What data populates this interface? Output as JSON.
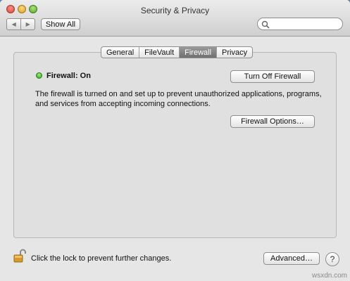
{
  "window": {
    "title": "Security & Privacy",
    "nav": {
      "back_icon": "chevron-left-icon",
      "forward_icon": "chevron-right-icon"
    },
    "show_all_label": "Show All",
    "search": {
      "placeholder": "",
      "icon": "search-icon"
    }
  },
  "tabs": [
    {
      "label": "General",
      "active": false
    },
    {
      "label": "FileVault",
      "active": false
    },
    {
      "label": "Firewall",
      "active": true
    },
    {
      "label": "Privacy",
      "active": false
    }
  ],
  "firewall": {
    "status_label": "Firewall: On",
    "status_color": "#2d9b1e",
    "turn_off_label": "Turn Off Firewall",
    "description": "The firewall is turned on and set up to prevent unauthorized applications, programs, and services from accepting incoming connections.",
    "options_label": "Firewall Options…"
  },
  "footer": {
    "lock_icon": "lock-open-icon",
    "lock_text": "Click the lock to prevent further changes.",
    "advanced_label": "Advanced…",
    "help_label": "?"
  },
  "watermark": "wsxdn.com"
}
